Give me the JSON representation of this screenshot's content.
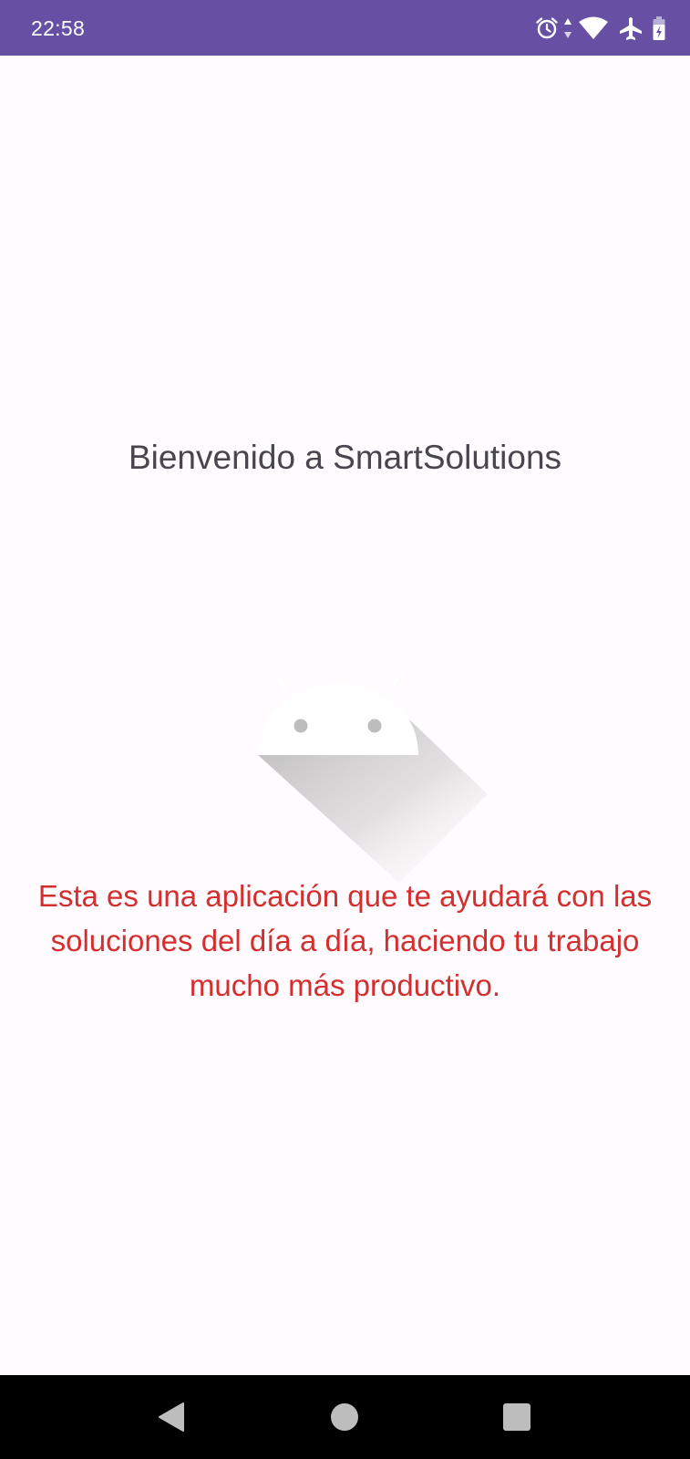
{
  "status_bar": {
    "time": "22:58",
    "icons": [
      "alarm-icon",
      "data-activity-icon",
      "wifi-icon",
      "airplane-mode-icon",
      "battery-charging-icon"
    ],
    "background_color": "#6750A4"
  },
  "main": {
    "title": "Bienvenido a SmartSolutions",
    "logo_icon": "android-logo",
    "description": "Esta es una aplicación que te ayudará con las soluciones del día a día, haciendo tu trabajo mucho más productivo.",
    "title_color": "#49454F",
    "description_color": "#D32F2F",
    "background_color": "#FFFBFE"
  },
  "nav_bar": {
    "buttons": [
      "back-icon",
      "home-icon",
      "recents-icon"
    ]
  }
}
